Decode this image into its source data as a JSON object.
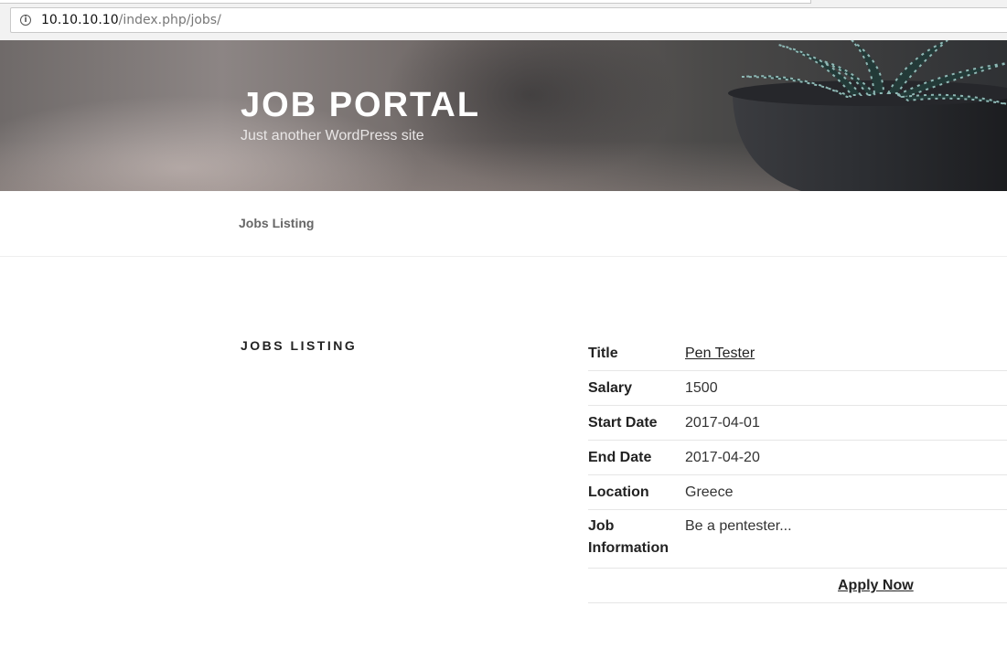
{
  "browser": {
    "url_host": "10.10.10.10",
    "url_path": "/index.php/jobs/",
    "info_icon": "info-icon"
  },
  "header": {
    "site_title": "JOB PORTAL",
    "tagline": "Just another WordPress site"
  },
  "nav": {
    "items": [
      {
        "label": "Jobs Listing"
      }
    ]
  },
  "main": {
    "page_title": "JOBS LISTING",
    "job": {
      "rows": [
        {
          "label": "Title",
          "value": "Pen Tester"
        },
        {
          "label": "Salary",
          "value": "1500"
        },
        {
          "label": "Start Date",
          "value": "2017-04-01"
        },
        {
          "label": "End Date",
          "value": "2017-04-20"
        },
        {
          "label": "Location",
          "value": "Greece"
        },
        {
          "label": "Job Information",
          "value": "Be a pentester..."
        }
      ],
      "apply_label": "Apply Now"
    }
  }
}
